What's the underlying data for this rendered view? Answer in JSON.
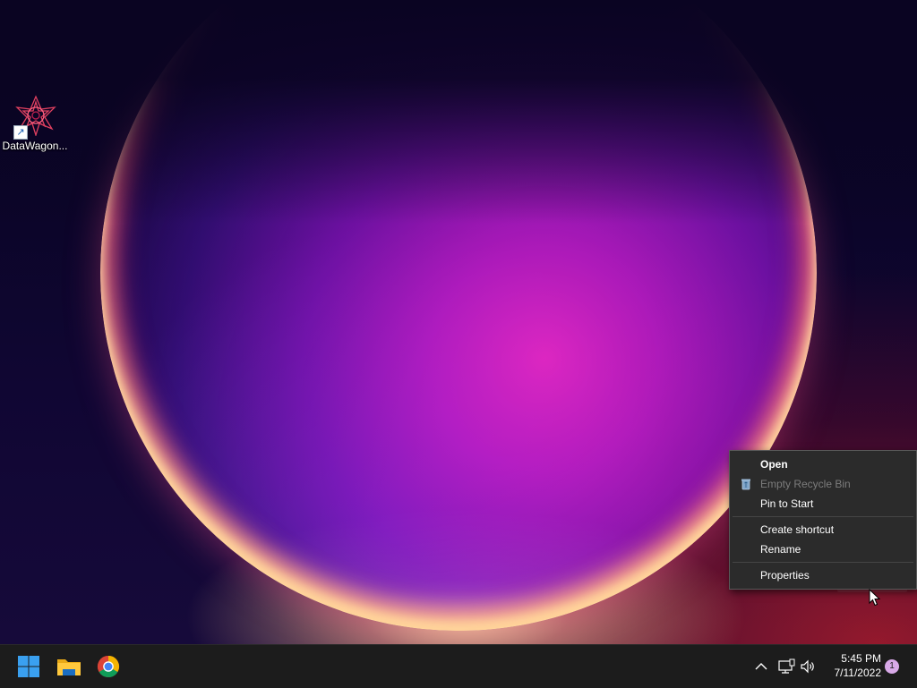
{
  "desktop": {
    "icons": [
      {
        "label": "DataWagon..."
      }
    ]
  },
  "context_menu": {
    "items": [
      {
        "label": "Open",
        "bold": true,
        "enabled": true
      },
      {
        "label": "Empty Recycle Bin",
        "enabled": false,
        "icon": "recycle-bin-icon"
      },
      {
        "label": "Pin to Start",
        "enabled": true
      },
      {
        "label": "Create shortcut",
        "enabled": true
      },
      {
        "label": "Rename",
        "enabled": true
      },
      {
        "label": "Properties",
        "enabled": true
      }
    ]
  },
  "taskbar": {
    "pinned": [
      {
        "name": "start-button",
        "icon": "windows-logo-icon"
      },
      {
        "name": "file-explorer",
        "icon": "folder-icon"
      },
      {
        "name": "chrome",
        "icon": "chrome-icon"
      }
    ],
    "tray": {
      "icons": [
        "chevron-up-icon",
        "network-icon",
        "volume-icon"
      ],
      "time": "5:45 PM",
      "date": "7/11/2022",
      "notification_count": "1"
    }
  },
  "colors": {
    "taskbar_bg": "#1c1c1c",
    "menu_bg": "#2b2b2b",
    "disabled_text": "#7c7c7c",
    "notification_badge": "#d8a9e8"
  }
}
